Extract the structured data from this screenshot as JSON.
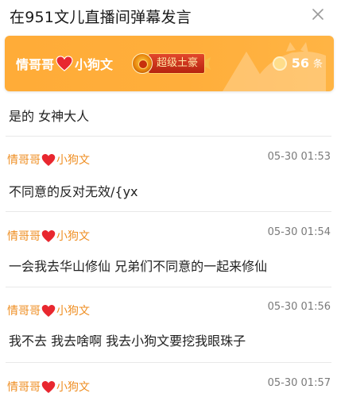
{
  "header": {
    "title": "在951文儿直播间弹幕发言"
  },
  "banner": {
    "name_part1": "情哥哥",
    "name_part2": "小狗文",
    "badge_label": "超级土豪",
    "count": "56",
    "count_unit": "条"
  },
  "top_message": "是的 女神大人",
  "messages": [
    {
      "user_part1": "情哥哥",
      "user_part2": "小狗文",
      "time": "05-30 01:53",
      "text": "不同意的反对无效/{yx"
    },
    {
      "user_part1": "情哥哥",
      "user_part2": "小狗文",
      "time": "05-30 01:54",
      "text": "一会我去华山修仙 兄弟们不同意的一起来修仙"
    },
    {
      "user_part1": "情哥哥",
      "user_part2": "小狗文",
      "time": "05-30 01:56",
      "text": "我不去 我去啥啊 我去小狗文要挖我眼珠子"
    },
    {
      "user_part1": "情哥哥",
      "user_part2": "小狗文",
      "time": "05-30 01:57",
      "text": ""
    }
  ],
  "icons": {
    "close": "close-icon",
    "heart": "heart-icon",
    "coin": "coin-icon",
    "medal": "medal-icon"
  },
  "colors": {
    "banner": "#ffac38",
    "username": "#ef8e22",
    "badge": "#c9301a"
  }
}
